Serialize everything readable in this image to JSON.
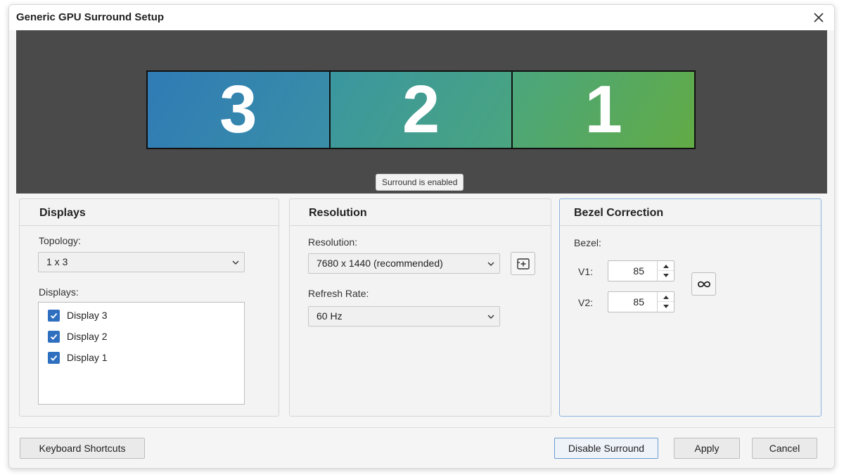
{
  "window": {
    "title": "Generic GPU Surround Setup"
  },
  "preview": {
    "monitors": [
      "3",
      "2",
      "1"
    ],
    "status": "Surround is enabled"
  },
  "displays_panel": {
    "heading": "Displays",
    "topology_label": "Topology:",
    "topology_value": "1 x 3",
    "displays_label": "Displays:",
    "items": [
      {
        "label": "Display 3",
        "checked": true
      },
      {
        "label": "Display 2",
        "checked": true
      },
      {
        "label": "Display 1",
        "checked": true
      }
    ]
  },
  "resolution_panel": {
    "heading": "Resolution",
    "resolution_label": "Resolution:",
    "resolution_value": "7680 x 1440 (recommended)",
    "refresh_label": "Refresh Rate:",
    "refresh_value": "60 Hz",
    "custom_icon": "add-custom-resolution-icon"
  },
  "bezel_panel": {
    "heading": "Bezel Correction",
    "bezel_label": "Bezel:",
    "v1_label": "V1:",
    "v1_value": "85",
    "v2_label": "V2:",
    "v2_value": "85",
    "link_icon": "link-icon"
  },
  "footer": {
    "keyboard_shortcuts": "Keyboard Shortcuts",
    "disable_surround": "Disable Surround",
    "apply": "Apply",
    "cancel": "Cancel"
  },
  "colors": {
    "accent": "#2f6fc0",
    "preview_bg": "#4a4a4a",
    "active_panel_border": "#8ab4e0"
  }
}
